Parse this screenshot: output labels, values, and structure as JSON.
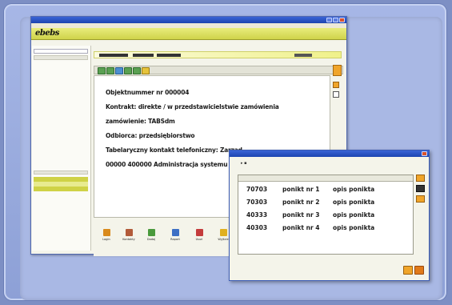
{
  "window": {
    "title": "",
    "menu": [
      "",
      "",
      ""
    ],
    "logo": "ebebs",
    "path_crumbs": [
      "",
      "",
      ""
    ]
  },
  "sidebar": {
    "header": "",
    "rows": [
      {
        "label": "",
        "style": "sel"
      },
      {
        "label": "",
        "style": "sel2"
      },
      {
        "label": "",
        "style": "sel"
      }
    ]
  },
  "content": {
    "lines": [
      "Objektnummer nr 000004",
      "Kontrakt: direkte / w przedstawicielstwie zamówienia",
      "zamówienie: TABSdm",
      "Odbiorca: przedsiębiorstwo",
      "Tabelaryczny kontakt telefoniczny: Zarząd",
      "00000 400000 Administracja systemu"
    ]
  },
  "bottombar": {
    "items": [
      {
        "label": "Login",
        "color": "#d98a1c",
        "icon": "user-icon"
      },
      {
        "label": "Kontakty",
        "color": "#b25b3a",
        "icon": "contacts-icon"
      },
      {
        "label": "Dodaj",
        "color": "#4a9a3c",
        "icon": "add-icon"
      },
      {
        "label": "Raport",
        "color": "#3d6fc4",
        "icon": "report-icon"
      },
      {
        "label": "Usuń",
        "color": "#c43c3c",
        "icon": "delete-icon"
      },
      {
        "label": "Wyjście",
        "color": "#e0b020",
        "icon": "exit-icon"
      }
    ]
  },
  "dialog": {
    "title": "",
    "columns": [
      "",
      "",
      "",
      ""
    ],
    "rows": [
      {
        "code": "70703",
        "name": "ponikt nr 1",
        "desc": "opis ponikta"
      },
      {
        "code": "70303",
        "name": "ponikt nr 2",
        "desc": "opis ponikta"
      },
      {
        "code": "40333",
        "name": "ponikt nr 3",
        "desc": "opis ponikta"
      },
      {
        "code": "40303",
        "name": "ponikt nr 4",
        "desc": "opis ponikta"
      }
    ],
    "ok_color": "#f0a52a",
    "cancel_color": "#e07a1a"
  }
}
